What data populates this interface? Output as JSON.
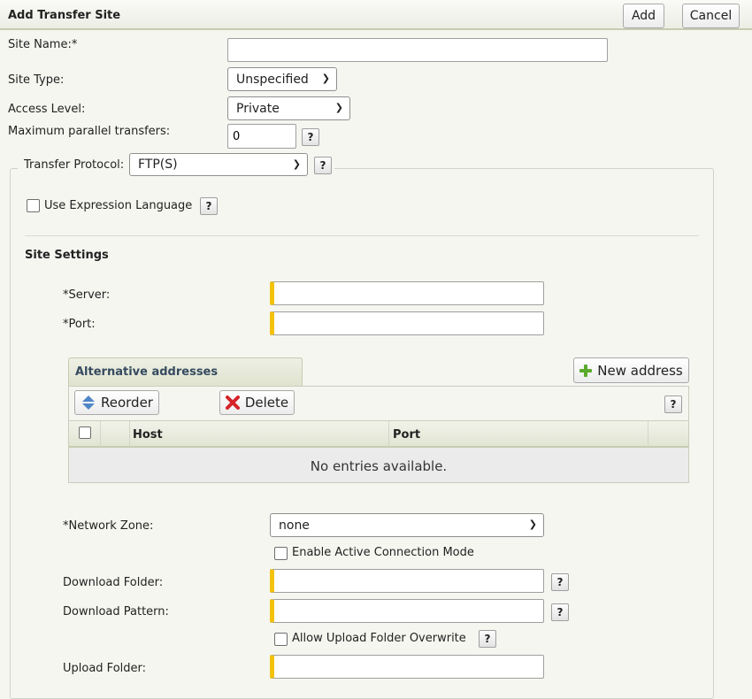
{
  "dialog": {
    "title": "Add Transfer Site",
    "add_label": "Add",
    "cancel_label": "Cancel"
  },
  "form": {
    "site_name_label": "Site Name:*",
    "site_name_value": "",
    "site_type_label": "Site Type:",
    "site_type_value": "Unspecified",
    "access_level_label": "Access Level:",
    "access_level_value": "Private",
    "max_parallel_label": "Maximum parallel transfers:",
    "max_parallel_value": "0",
    "help_label": "?",
    "protocol_label": "Transfer Protocol:",
    "protocol_value": "FTP(S)",
    "expression_language_label": "Use Expression Language"
  },
  "site_settings": {
    "heading": "Site Settings",
    "server_label": "*Server:",
    "server_value": "",
    "port_label": "*Port:",
    "port_value": ""
  },
  "alt_addresses": {
    "title": "Alternative addresses",
    "new_address_label": "New address",
    "reorder_label": "Reorder",
    "delete_label": "Delete",
    "columns": [
      "Host",
      "Port"
    ],
    "empty_text": "No entries available."
  },
  "network": {
    "zone_label": "*Network Zone:",
    "zone_value": "none",
    "active_mode_label": "Enable Active Connection Mode",
    "download_folder_label": "Download Folder:",
    "download_folder_value": "",
    "download_pattern_label": "Download Pattern:",
    "download_pattern_value": "",
    "upload_overwrite_label": "Allow Upload Folder Overwrite",
    "upload_folder_label": "Upload Folder:",
    "upload_folder_value": ""
  },
  "colors": {
    "required_marker": "#f4c20d",
    "header_bg": "#eceee5",
    "accent_text": "#354a5f"
  }
}
